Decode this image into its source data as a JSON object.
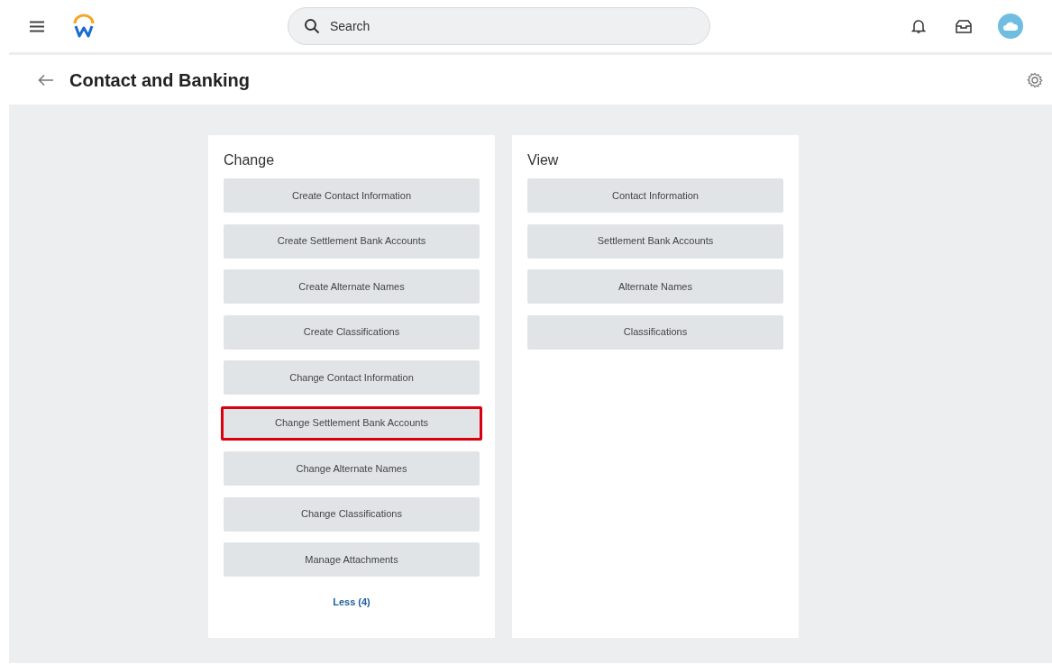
{
  "header": {
    "search": {
      "placeholder": "Search"
    }
  },
  "page": {
    "title": "Contact and Banking"
  },
  "panels": [
    {
      "title": "Change",
      "actions": [
        {
          "label": "Create Contact Information",
          "highlighted": false
        },
        {
          "label": "Create Settlement Bank Accounts",
          "highlighted": false
        },
        {
          "label": "Create Alternate Names",
          "highlighted": false
        },
        {
          "label": "Create Classifications",
          "highlighted": false
        },
        {
          "label": "Change Contact Information",
          "highlighted": false
        },
        {
          "label": "Change Settlement Bank Accounts",
          "highlighted": true
        },
        {
          "label": "Change Alternate Names",
          "highlighted": false
        },
        {
          "label": "Change Classifications",
          "highlighted": false
        },
        {
          "label": "Manage Attachments",
          "highlighted": false
        }
      ],
      "toggle_link": "Less (4)"
    },
    {
      "title": "View",
      "actions": [
        {
          "label": "Contact Information",
          "highlighted": false
        },
        {
          "label": "Settlement Bank Accounts",
          "highlighted": false
        },
        {
          "label": "Alternate Names",
          "highlighted": false
        },
        {
          "label": "Classifications",
          "highlighted": false
        }
      ]
    }
  ]
}
